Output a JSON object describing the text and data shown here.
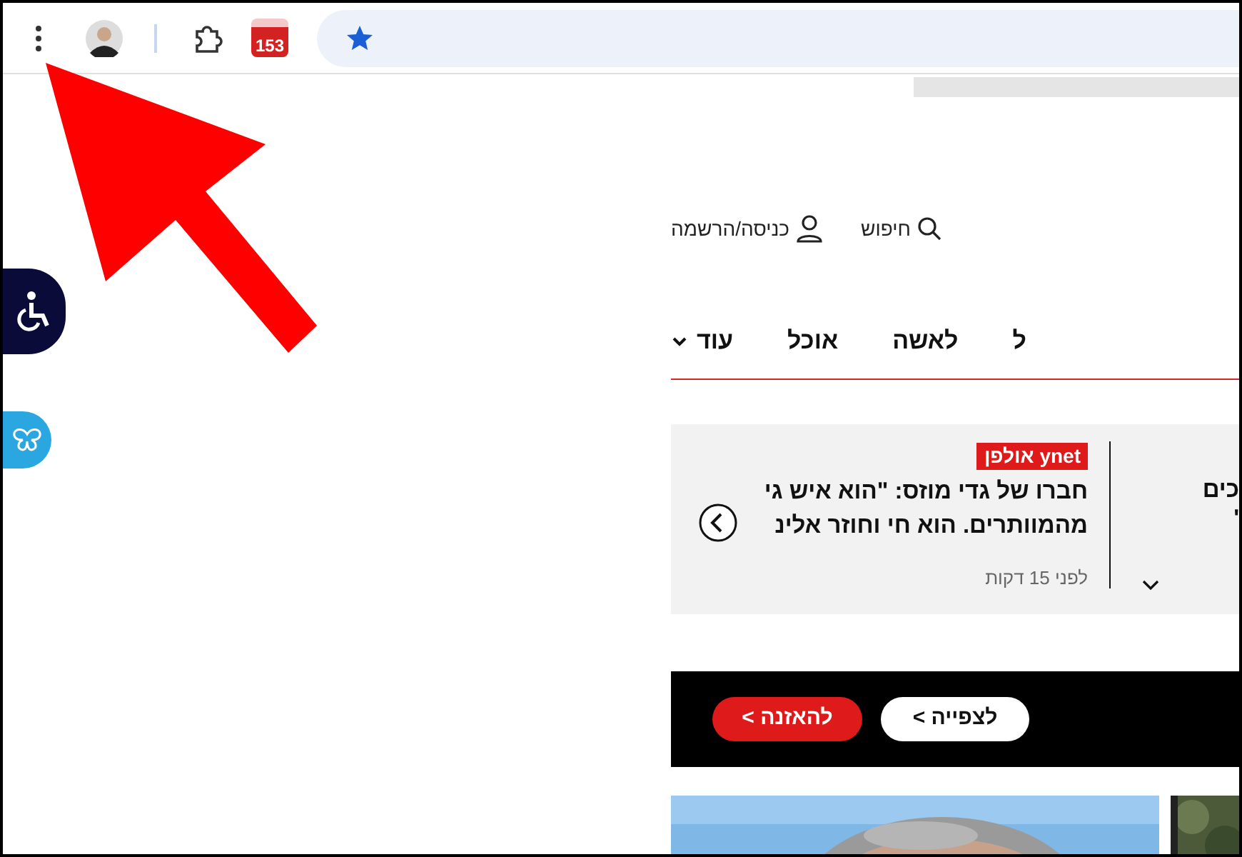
{
  "toolbar": {
    "mail_badge": "153"
  },
  "header": {
    "search": "חיפוש",
    "login": "כניסה/הרשמה"
  },
  "nav": [
    {
      "label": "ל",
      "kind": "link"
    },
    {
      "label": "לאשה",
      "kind": "link"
    },
    {
      "label": "אוכל",
      "kind": "link"
    },
    {
      "label": "עוד",
      "kind": "dropdown"
    }
  ],
  "ticker": {
    "partial_item": {
      "lines": [
        "כים",
        "'"
      ]
    },
    "item": {
      "tag": "אולפן ynet",
      "lines": [
        "חברו של גדי מוזס: \"הוא איש גי",
        "מהמוותרים. הוא חי וחוזר אלינ"
      ],
      "time": "לפני 15 דקות"
    }
  },
  "media_bar": {
    "buttons": [
      {
        "label": "לצפייה >",
        "kind": "secondary"
      },
      {
        "label": "להאזנה >",
        "kind": "primary"
      }
    ]
  }
}
